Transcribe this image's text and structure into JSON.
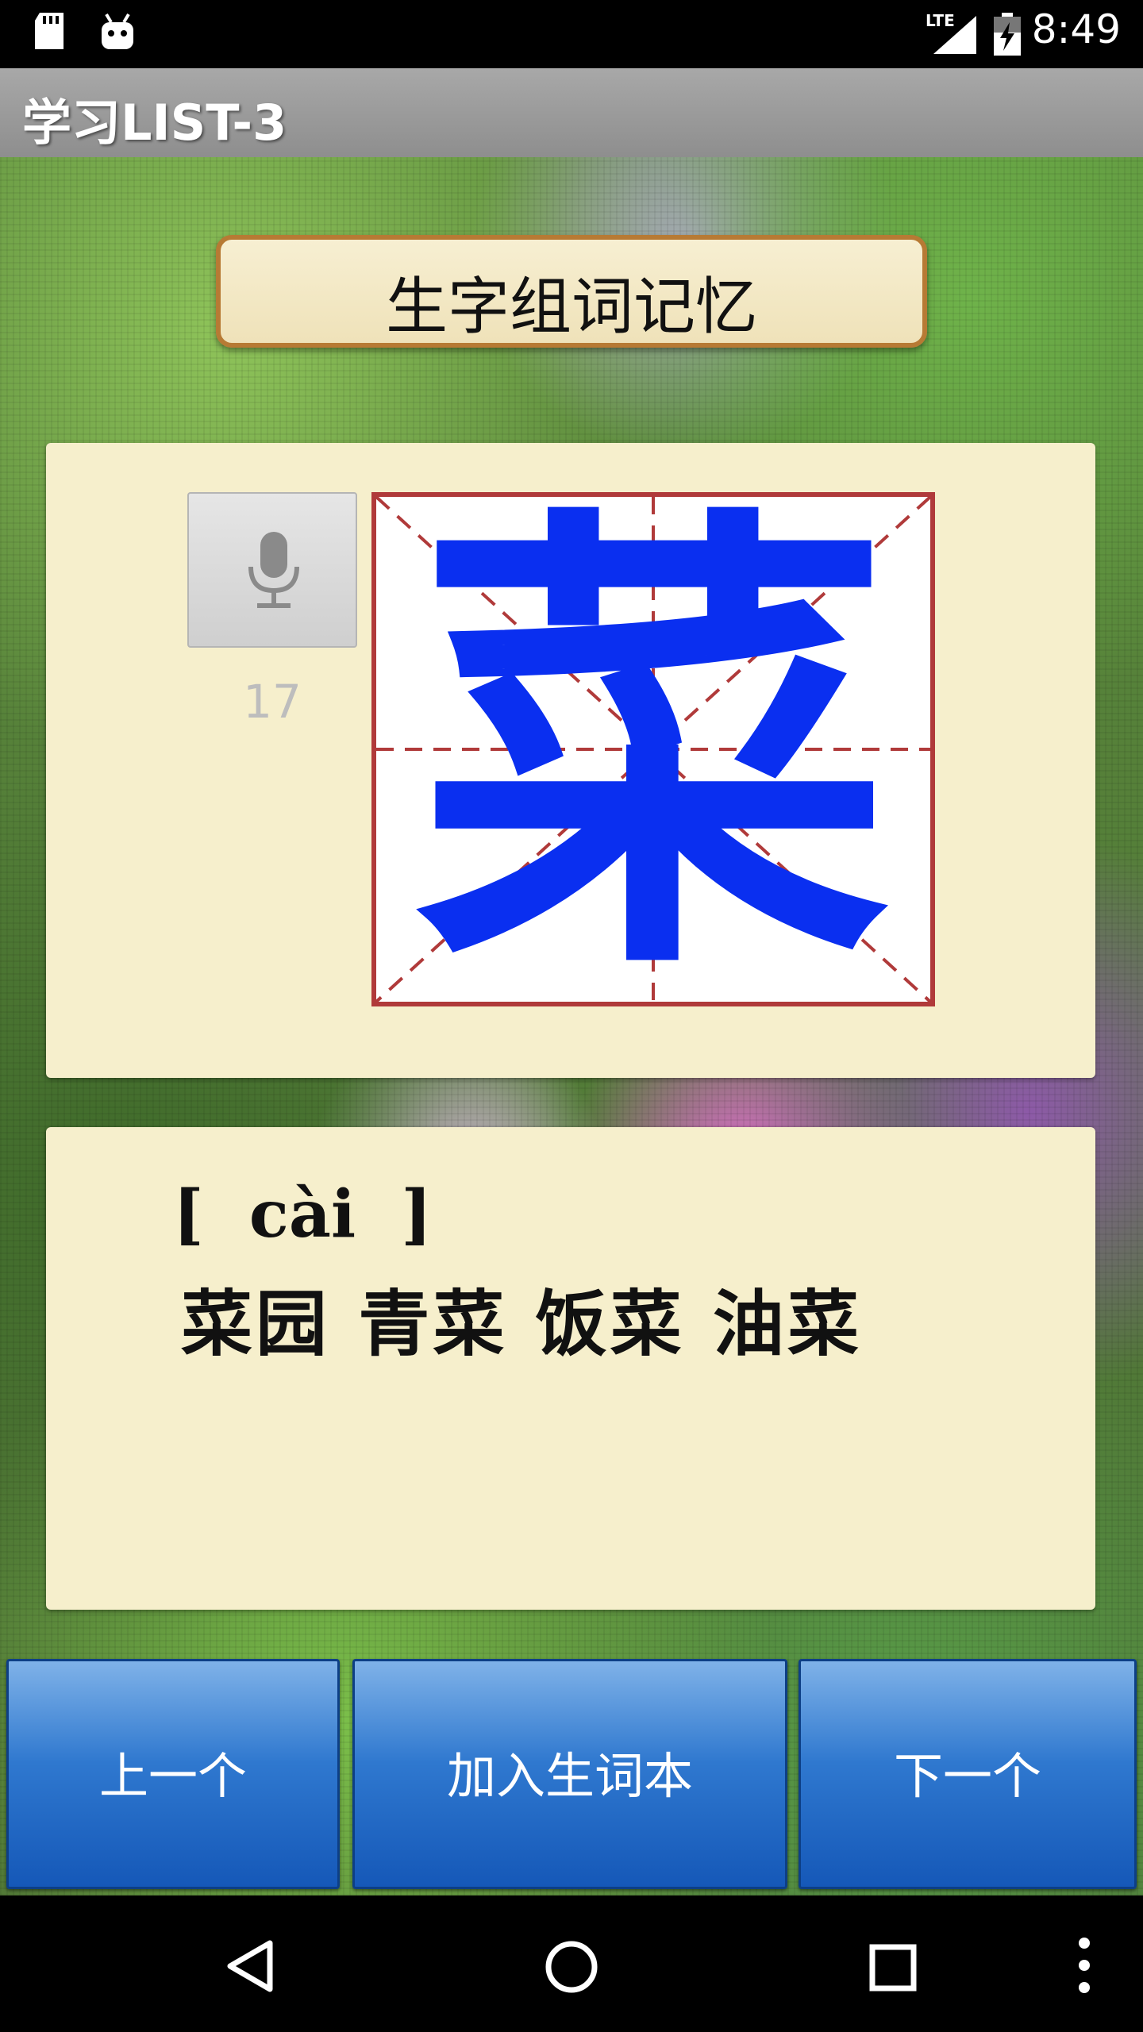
{
  "status_bar": {
    "time": "8:49",
    "network": "LTE",
    "icons": [
      "sd-card-icon",
      "android-icon",
      "signal-icon",
      "battery-charging-icon"
    ]
  },
  "action_bar": {
    "title": "学习LIST-3"
  },
  "heading": {
    "text": "生字组词记忆"
  },
  "character_card": {
    "character": "菜",
    "stroke_count": "17",
    "icons": [
      "microphone-icon"
    ]
  },
  "word_card": {
    "pinyin": "[  cài  ]",
    "words": "菜园  青菜  饭菜  油菜"
  },
  "buttons": {
    "prev": "上一个",
    "add": "加入生词本",
    "next": "下一个"
  },
  "nav_bar": {
    "icons": [
      "back-icon",
      "home-icon",
      "recents-icon",
      "overflow-menu-icon"
    ]
  },
  "colors": {
    "character": "#0a2ff0",
    "grid_border": "#b03a3a",
    "button_blue": "#1558b8",
    "panel_bg": "#f6efcc"
  }
}
